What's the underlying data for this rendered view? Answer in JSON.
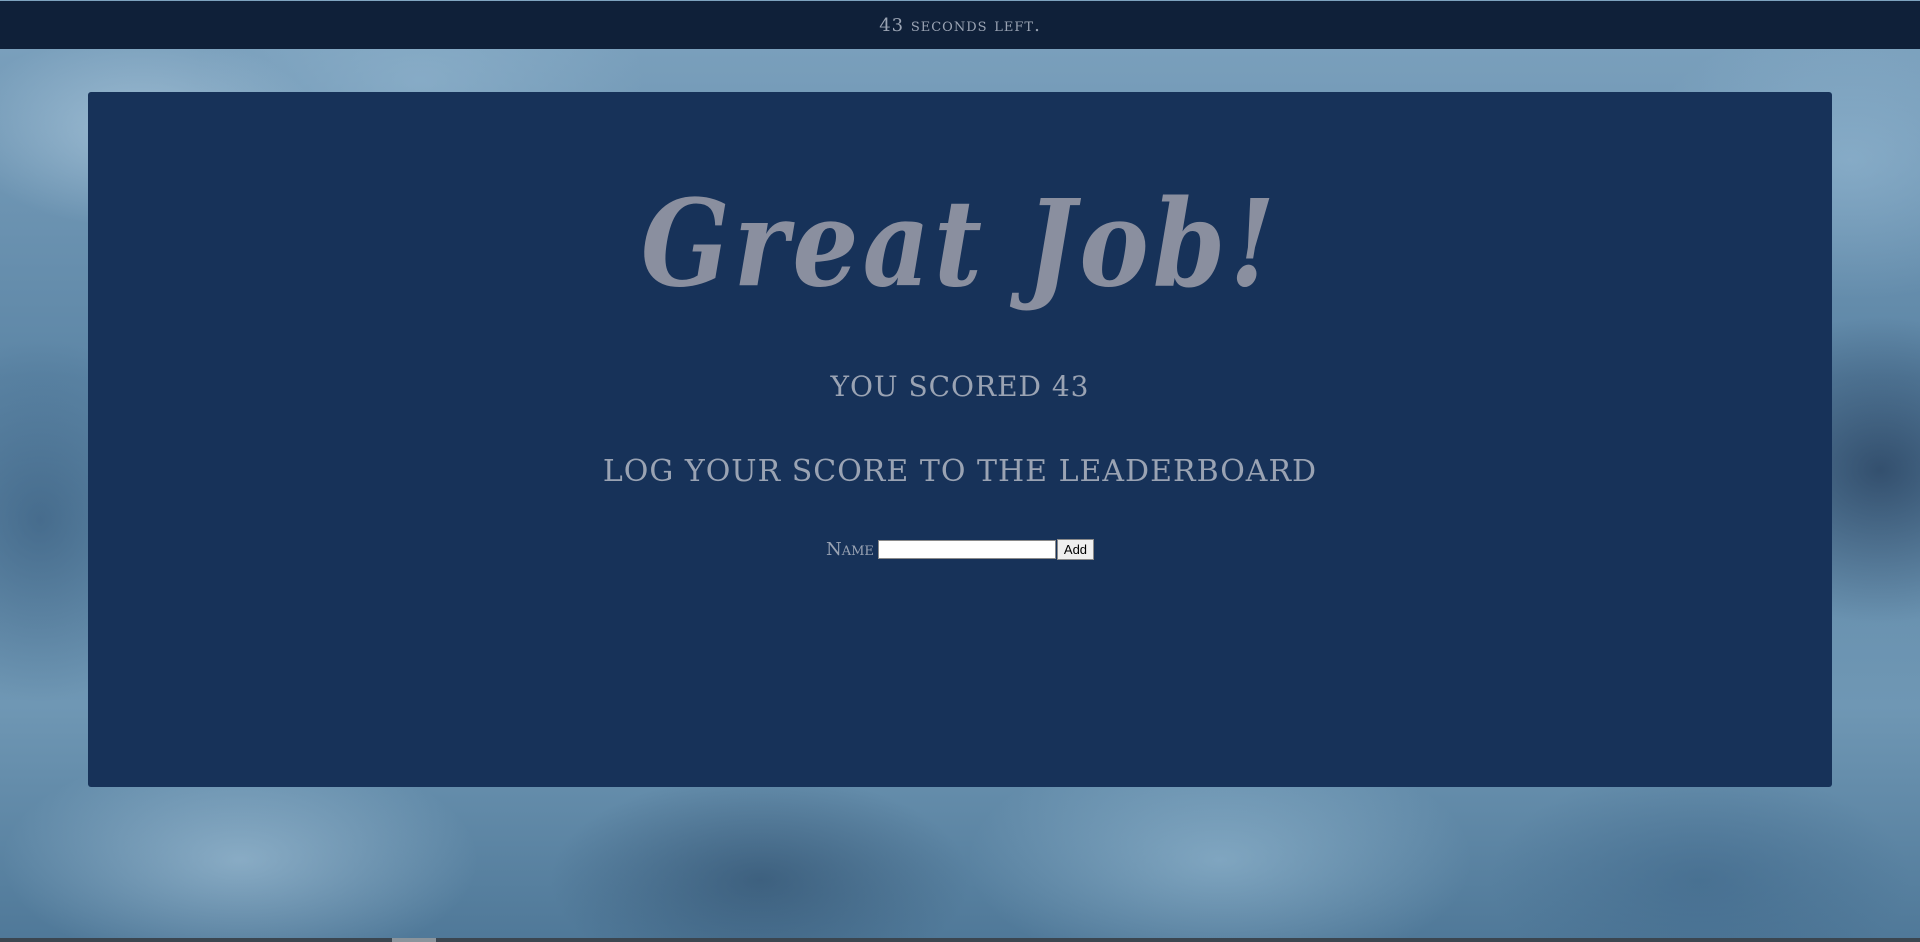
{
  "header": {
    "timer_text": "43 seconds left."
  },
  "main": {
    "title": "Great Job!",
    "score_text": "YOU SCORED 43",
    "leaderboard_heading": "LOG YOUR SCORE TO THE LEADERBOARD",
    "form": {
      "name_label": "Name",
      "name_value": "",
      "name_placeholder": "",
      "add_label": "Add"
    }
  },
  "colors": {
    "topbar": "#0f2039",
    "panel": "#173259",
    "text": "#9aa3b3",
    "title": "#8a8f9f"
  }
}
